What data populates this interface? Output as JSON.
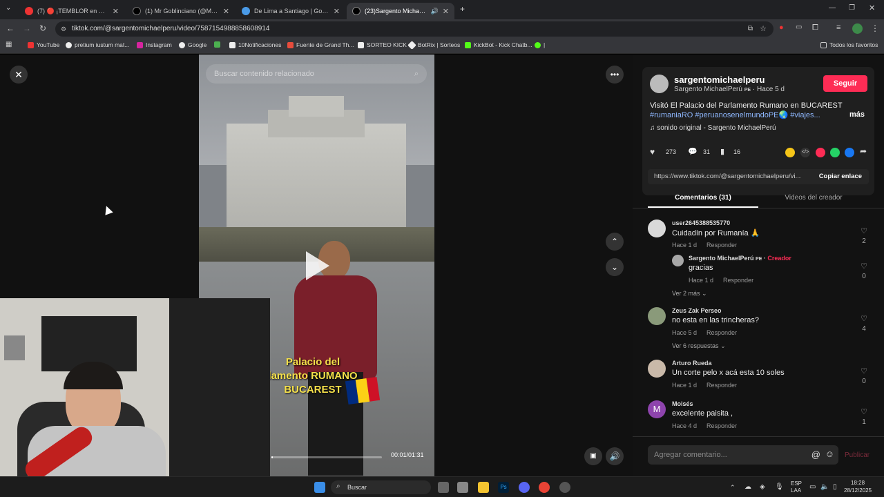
{
  "tabs": [
    {
      "label": "(7) 🔴 ¡TEMBLOR en VIVO! 🚨 | ",
      "color": "#e33"
    },
    {
      "label": "(1) Mr Goblinciano (@MGoblinc",
      "color": "#111"
    },
    {
      "label": "De Lima a Santiago | Google V",
      "color": "#4a9be8"
    },
    {
      "label": "(23)Sargento MichaelPerú",
      "color": "#111"
    }
  ],
  "url": "tiktok.com/@sargentomichaelperu/video/7587154988858608914",
  "bookmarks": [
    {
      "label": "YouTube",
      "color": "#e33"
    },
    {
      "label": "pretium iustum mat...",
      "color": "#eee"
    },
    {
      "label": "Instagram",
      "color": "#d6249f"
    },
    {
      "label": "Google",
      "color": "#eee"
    },
    {
      "label": "",
      "color": "#4caf50"
    },
    {
      "label": "10Notificaciones",
      "color": "#eee"
    },
    {
      "label": "Fuente de Grand Th...",
      "color": "#e74c3c"
    },
    {
      "label": "SORTEO KICK",
      "color": "#eee"
    },
    {
      "label": "BotRix | Sorteos",
      "color": "#eee"
    },
    {
      "label": "KickBot - Kick Chatb...",
      "color": "#53fc18"
    },
    {
      "label": "|",
      "color": "#53fc18"
    }
  ],
  "bookmarks_all": "Todos los favoritos",
  "video": {
    "search_placeholder": "Buscar contenido relacionado",
    "caption_line1": "Palacio del",
    "caption_line2": "lamento RUMANO",
    "caption_line3": "BUCAREST",
    "time": "00:01/01:31",
    "progress": 0.011
  },
  "post": {
    "username": "sargentomichaelperu",
    "display_name": "Sargento MichaelPerú",
    "flag_code": "PE",
    "age": "Hace 5 d",
    "follow_label": "Seguir",
    "description": "Visitó El Palacio del Parlamento Rumano en BUCAREST",
    "tags": "#rumaniaRO #peruanosenelmundoPE🌏 #viajes...",
    "more": "más",
    "sound": "sonido original - Sargento MichaelPerú",
    "likes": "273",
    "comments_count": "31",
    "saves": "16",
    "link": "https://www.tiktok.com/@sargentomichaelperu/vi...",
    "copy_label": "Copiar enlace"
  },
  "tabs_panel": {
    "comments": "Comentarios (31)",
    "videos": "Videos del creador"
  },
  "comments": [
    {
      "user": "user2645388535770",
      "text": "Cuidadín por Rumanía 🙏",
      "time": "Hace 1 d",
      "reply": "Responder",
      "likes": "2",
      "avatar": "#d9d9d9"
    },
    {
      "user": "Sargento MichaelPerú",
      "badge": "Creador",
      "text": "gracias",
      "time": "Hace 1 d",
      "reply": "Responder",
      "likes": "0",
      "avatar": "#a7a7a7"
    },
    {
      "user": "Zeus Zak Perseo",
      "text": "no esta en las trincheras?",
      "time": "Hace 5 d",
      "reply": "Responder",
      "likes": "4",
      "avatar": "#8a9a7a"
    },
    {
      "user": "Arturo Rueda",
      "text": "Un corte pelo x acá esta 10 soles",
      "time": "Hace 1 d",
      "reply": "Responder",
      "likes": "0",
      "avatar": "#c9b9a9"
    },
    {
      "user": "Moisés",
      "text": "excelente paisita ,",
      "time": "Hace 4 d",
      "reply": "Responder",
      "likes": "1",
      "avatar": "#8e44ad",
      "initial": "M"
    }
  ],
  "see_more_1": "Ver 2 más",
  "see_more_2": "Ver 6 respuestas",
  "comment_input_placeholder": "Agregar comentario...",
  "publish_label": "Publicar",
  "taskbar": {
    "search": "Buscar",
    "lang1": "ESP",
    "lang2": "LAA",
    "time": "18:28",
    "date": "28/12/2025"
  }
}
